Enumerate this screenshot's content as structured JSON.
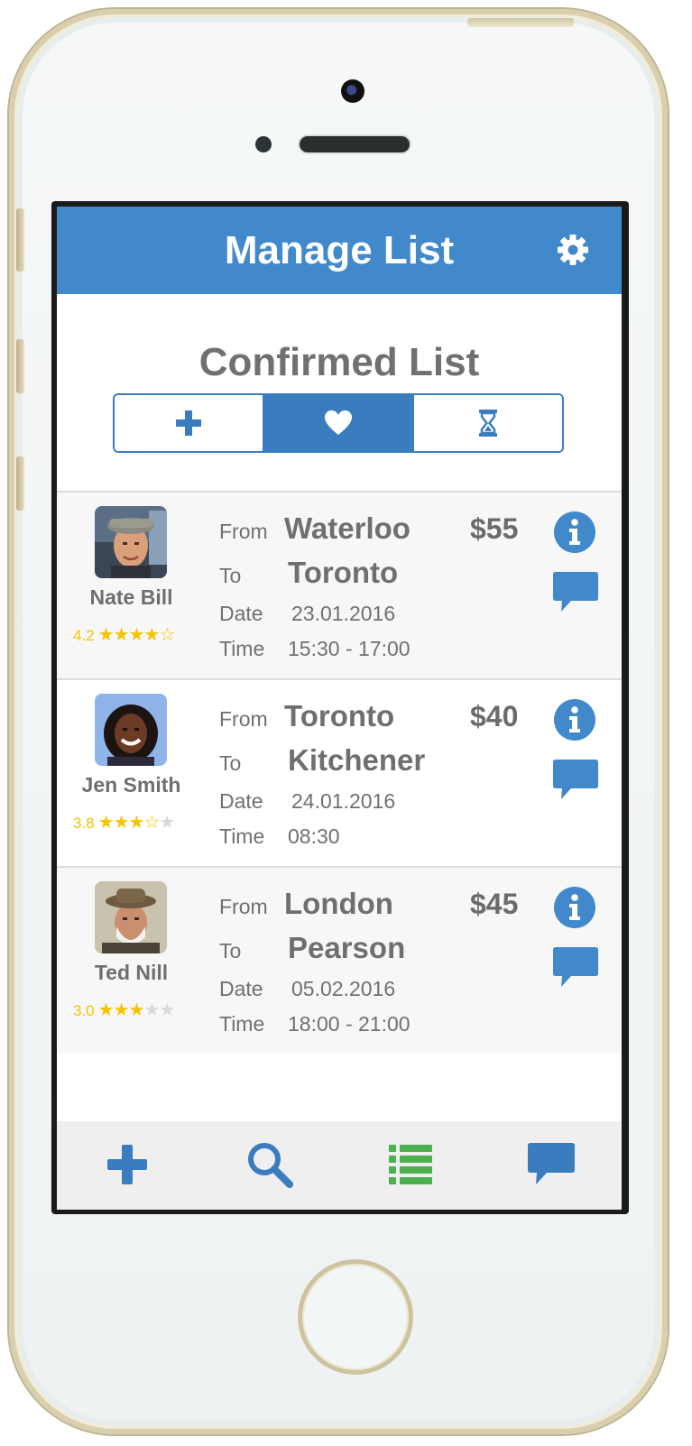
{
  "header": {
    "title": "Manage List",
    "settings_icon": "gear-icon"
  },
  "section_title": "Confirmed List",
  "segments": [
    {
      "icon": "plus-icon",
      "active": false
    },
    {
      "icon": "heart-icon",
      "active": true
    },
    {
      "icon": "hourglass-icon",
      "active": false
    }
  ],
  "labels": {
    "from": "From",
    "to": "To",
    "date": "Date",
    "time": "Time"
  },
  "rides": [
    {
      "name": "Nate Bill",
      "rating": "4.2",
      "stars_filled": 4,
      "from": "Waterloo",
      "to": "Toronto",
      "date": "23.01.2016",
      "time": "15:30 - 17:00",
      "price": "$55"
    },
    {
      "name": "Jen Smith",
      "rating": "3.8",
      "stars_filled": 3,
      "from": "Toronto",
      "to": "Kitchener",
      "date": "24.01.2016",
      "time": "08:30",
      "price": "$40"
    },
    {
      "name": "Ted Nill",
      "rating": "3.0",
      "stars_filled": 3,
      "from": "London",
      "to": "Pearson",
      "date": "05.02.2016",
      "time": "18:00 - 21:00",
      "price": "$45"
    }
  ],
  "tabbar": [
    {
      "icon": "plus-icon"
    },
    {
      "icon": "search-icon"
    },
    {
      "icon": "list-icon"
    },
    {
      "icon": "chat-icon"
    }
  ],
  "colors": {
    "accent": "#4189cb",
    "star": "#f5c400",
    "list_active": "#4caf50"
  }
}
